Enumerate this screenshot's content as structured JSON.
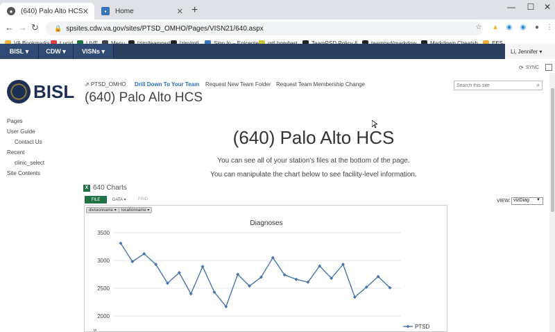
{
  "browser": {
    "tabs": [
      {
        "label": "(640) Palo Alto HCS",
        "active": true
      },
      {
        "label": "Home",
        "active": false
      }
    ],
    "url": "spsites.cdw.va.gov/sites/PTSD_OMHO/Pages/VISN21/640.aspx",
    "bookmarks": [
      {
        "label": "VA Bookmarks",
        "color": "#f2b134"
      },
      {
        "label": "Lucid",
        "color": "#e0433c"
      },
      {
        "label": "LIVE",
        "color": "#217346"
      },
      {
        "label": "Menu",
        "color": "#444444"
      },
      {
        "label": "lzim/teampsd",
        "color": "#222222"
      },
      {
        "label": "lzim/mtl",
        "color": "#222222"
      },
      {
        "label": "Sign In – Epicenter",
        "color": "#3b73b9"
      },
      {
        "label": "mtl.how/test",
        "color": "#ccc23a"
      },
      {
        "label": "TeamPSD Policy &...",
        "color": "#222222"
      },
      {
        "label": "teampsd/markdow...",
        "color": "#222222"
      },
      {
        "label": "Markdown Cheatsh...",
        "color": "#222222"
      },
      {
        "label": "EES",
        "color": "#f2b134"
      }
    ]
  },
  "suite": {
    "buttons": [
      "BISL",
      "CDW",
      "VISNs"
    ],
    "user": "Li, Jennifer",
    "sync_label": "SYNC"
  },
  "header": {
    "logo_text": "BISL",
    "nav": [
      "PTSD_OMHO",
      "Drill Down To Your Team",
      "Request New Team Folder",
      "Request Team Membership Change"
    ],
    "site_title": "(640) Palo Alto HCS",
    "search_placeholder": "Search this site"
  },
  "leftnav": {
    "items": [
      "Pages",
      "User Guide",
      "Contact Us",
      "Recent",
      "clinic_select",
      "Site Contents"
    ]
  },
  "main": {
    "title": "(640) Palo Alto HCS",
    "line1": "You can see all of your station's files at the bottom of the page.",
    "line2": "You can manipulate the chart below to see facility-level information.",
    "charts_title": "640 Charts",
    "ribbon": [
      "FILE",
      "DATA",
      "FIND"
    ],
    "view_label": "VIEW:",
    "view_value": "vizDiag",
    "filters": [
      "divisionname",
      "locationname"
    ]
  },
  "chart_data": {
    "type": "line",
    "title": "Diagnoses",
    "y_ticks": [
      3500,
      3000,
      2500,
      2000
    ],
    "ylim": [
      2000,
      3500
    ],
    "ylabel_fragment": "ts",
    "series": [
      {
        "name": "PTSD",
        "color": "#4a76a8",
        "values": [
          3310,
          2980,
          3120,
          2930,
          2590,
          2780,
          2400,
          2890,
          2430,
          2170,
          2750,
          2540,
          2700,
          3050,
          2740,
          2660,
          2610,
          2900,
          2680,
          2930,
          2340,
          2520,
          2710,
          2510
        ]
      }
    ],
    "legend": "right"
  }
}
